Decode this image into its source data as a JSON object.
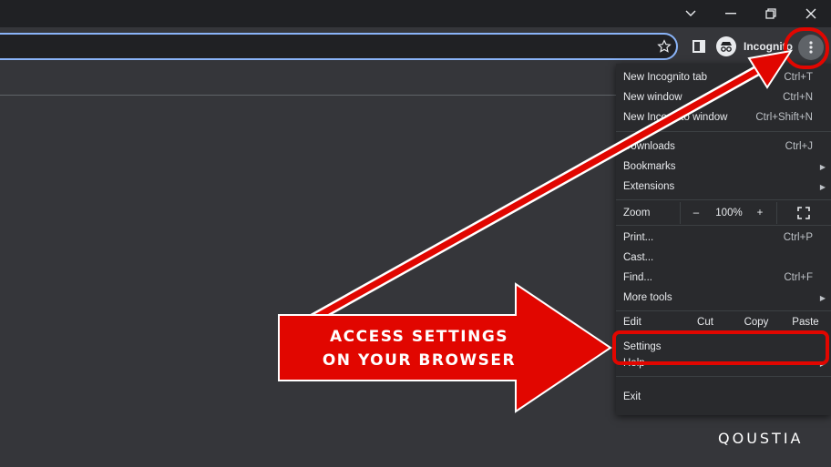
{
  "toolbar": {
    "incognito_label": "Incognito"
  },
  "menu": {
    "items_top": [
      {
        "label": "New Incognito tab",
        "shortcut": "Ctrl+T"
      },
      {
        "label": "New window",
        "shortcut": "Ctrl+N"
      },
      {
        "label": "New Incognito window",
        "shortcut": "Ctrl+Shift+N"
      }
    ],
    "downloads": {
      "label": "Downloads",
      "shortcut": "Ctrl+J"
    },
    "bookmarks": {
      "label": "Bookmarks"
    },
    "extensions": {
      "label": "Extensions"
    },
    "zoom": {
      "label": "Zoom",
      "minus": "–",
      "value": "100%",
      "plus": "+"
    },
    "print": {
      "label": "Print...",
      "shortcut": "Ctrl+P"
    },
    "cast": {
      "label": "Cast..."
    },
    "find": {
      "label": "Find...",
      "shortcut": "Ctrl+F"
    },
    "more_tools": {
      "label": "More tools"
    },
    "edit": {
      "label": "Edit",
      "cut": "Cut",
      "copy": "Copy",
      "paste": "Paste"
    },
    "settings": {
      "label": "Settings"
    },
    "help": {
      "label": "Help"
    },
    "exit": {
      "label": "Exit"
    }
  },
  "overlay": {
    "line1": "ACCESS SETTINGS",
    "line2": "ON YOUR BROWSER",
    "accent_color": "#e10600"
  },
  "brand": {
    "name": "QOUSTIA"
  },
  "colors": {
    "frame": "#202124",
    "toolbar": "#35363a",
    "menu_bg": "#292a2d",
    "focus_ring": "#8ab4f8"
  }
}
